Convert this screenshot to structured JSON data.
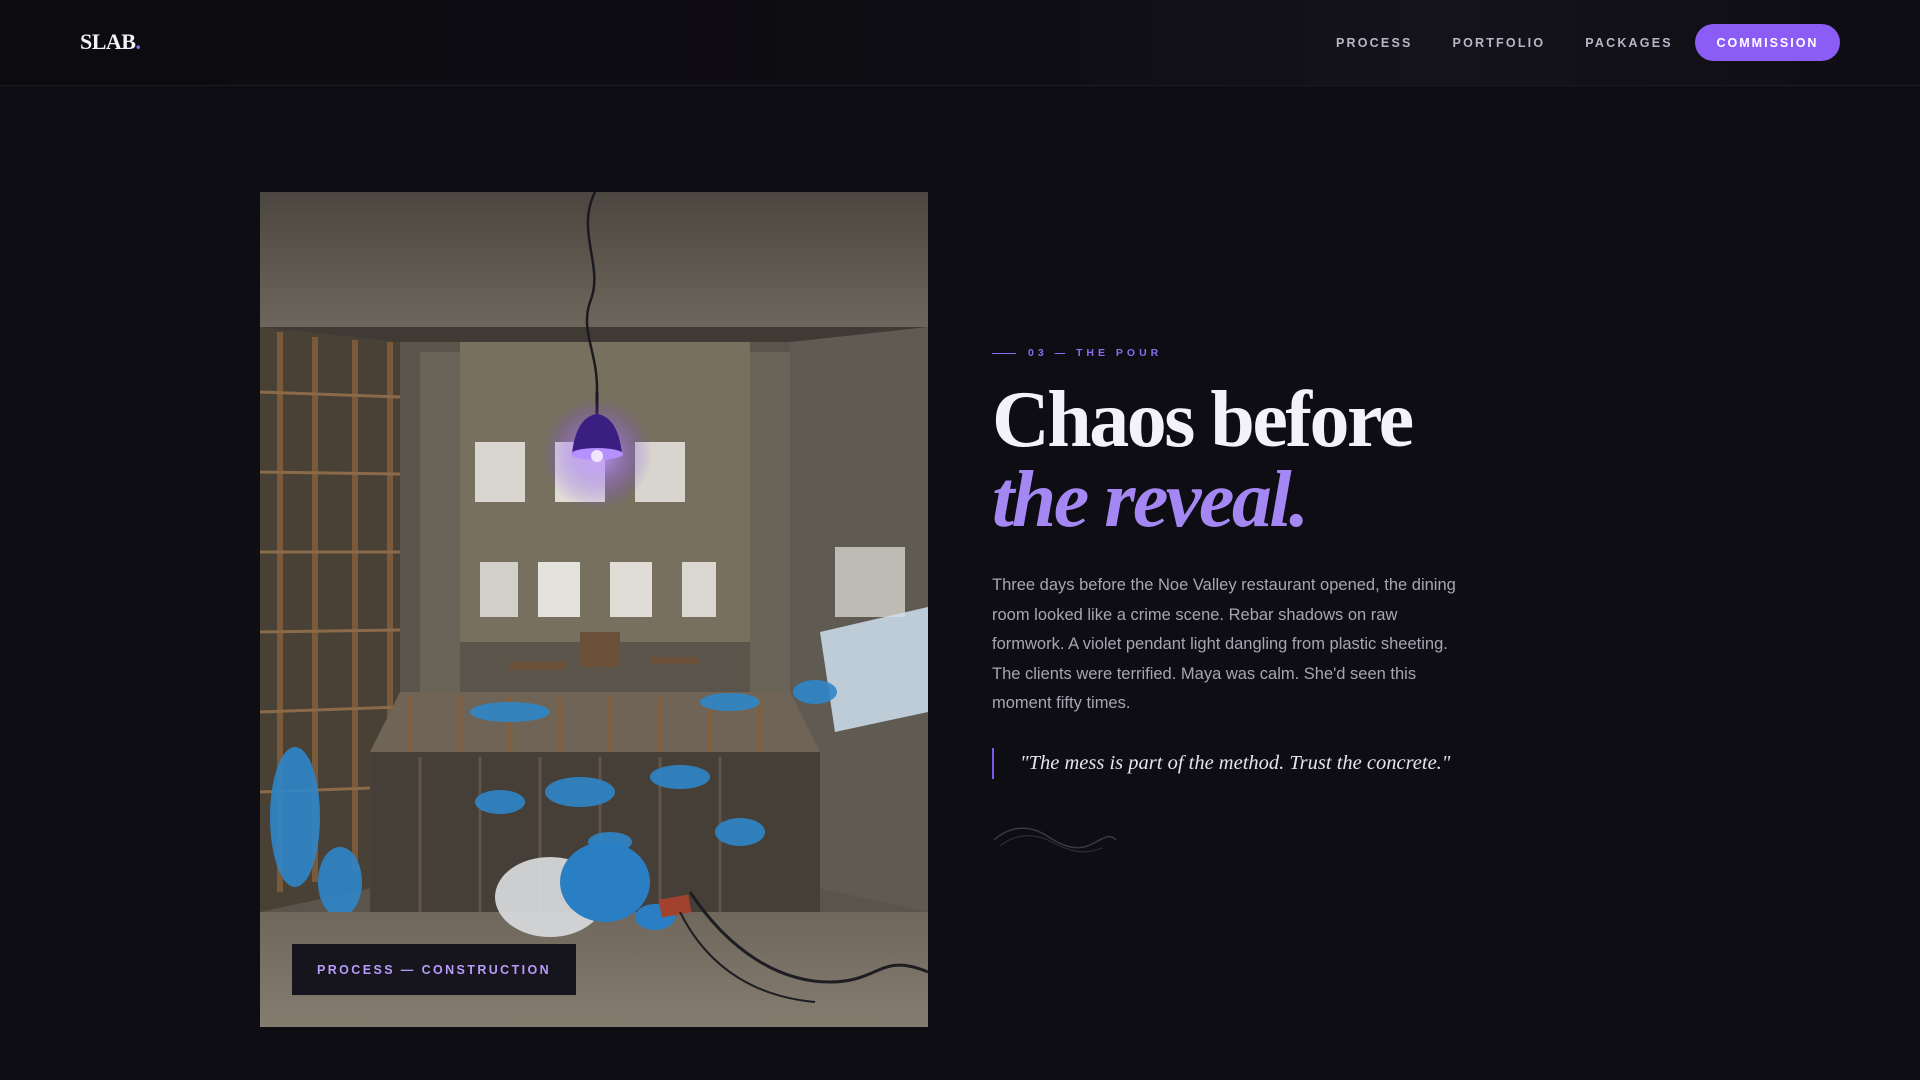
{
  "brand": {
    "name": "SLAB",
    "dot": "."
  },
  "nav": {
    "links": [
      "PROCESS",
      "PORTFOLIO",
      "PACKAGES"
    ],
    "cta_label": "COMMISSION"
  },
  "colors": {
    "accent": "#8b5cf6",
    "accent_text": "#a487f3",
    "background": "#0e0d13"
  },
  "hero": {
    "eyebrow": "03 — THE POUR",
    "headline_line1": "Chaos before",
    "headline_line2": "the reveal.",
    "body": "Three days before the Noe Valley restaurant opened, the dining room looked like a crime scene. Rebar shadows on raw formwork. A violet pendant light dangling from plastic sheeting. The clients were terrified. Maya was calm. She'd seen this moment fifty times.",
    "quote": "\"The mess is part of the method. Trust the concrete.\"",
    "image_caption": "PROCESS — CONSTRUCTION"
  }
}
